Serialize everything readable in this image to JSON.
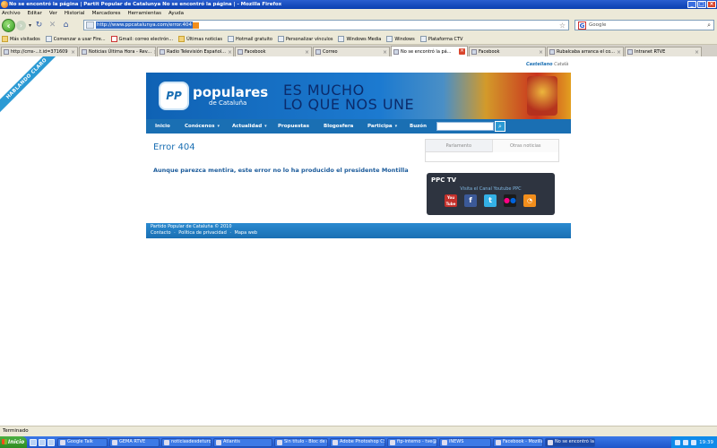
{
  "browser": {
    "title": "No se encontró la página | Partit Popular de Catalunya No se encontró la página | - Mozilla Firefox",
    "menu": [
      "Archivo",
      "Editar",
      "Ver",
      "Historial",
      "Marcadores",
      "Herramientas",
      "Ayuda"
    ],
    "url": "http://www.ppcatalunya.com/error.404",
    "search_placeholder": "Google",
    "status": "Terminado"
  },
  "bookmarks": [
    {
      "label": "Más visitados",
      "icon": "folder-icon"
    },
    {
      "label": "Comenzar a usar Fire...",
      "icon": "page-icon"
    },
    {
      "label": "Gmail: correo electrón...",
      "icon": "gmail-icon"
    },
    {
      "label": "Últimas noticias",
      "icon": "folder-icon"
    },
    {
      "label": "Hotmail gratuito",
      "icon": "page-icon"
    },
    {
      "label": "Personalizar vínculos",
      "icon": "page-icon"
    },
    {
      "label": "Windows Media",
      "icon": "page-icon"
    },
    {
      "label": "Windows",
      "icon": "page-icon"
    },
    {
      "label": "Plataforma CTV",
      "icon": "page-icon"
    }
  ],
  "tabs": [
    {
      "label": "http://cms-...t.id=371609"
    },
    {
      "label": "Noticias Última Hora - Rev..."
    },
    {
      "label": "Radio Televisión Español..."
    },
    {
      "label": "Facebook"
    },
    {
      "label": "Correo"
    },
    {
      "label": "No se encontró la pá..."
    },
    {
      "label": "Facebook"
    },
    {
      "label": "Rubalcaba arranca el co..."
    },
    {
      "label": "Intranet RTVE"
    }
  ],
  "page": {
    "ribbon": "HABLANDO CLARO",
    "lang_1": "Castellano",
    "lang_2": "Català",
    "brand_logo": "PP",
    "brand_name": "populares",
    "brand_sub": "de Cataluña",
    "slogan_1": "ES MUCHO",
    "slogan_2": "LO QUE NOS UNE",
    "nav": [
      {
        "label": "Inicio",
        "caret": false
      },
      {
        "label": "Conócenos",
        "caret": true
      },
      {
        "label": "Actualidad",
        "caret": true
      },
      {
        "label": "Propuestas",
        "caret": false
      },
      {
        "label": "Blogosfera",
        "caret": false
      },
      {
        "label": "Participa",
        "caret": true
      },
      {
        "label": "Buzón",
        "caret": false
      }
    ],
    "error_title": "Error 404",
    "error_msg": "Aunque parezca mentira, este error no lo ha producido el presidente Montilla",
    "widget_tabs": [
      "Parlamento",
      "Otras noticias"
    ],
    "tv_title": "PPC TV",
    "tv_sub": "Visita el Canal Youtube PPC",
    "socials": [
      "youtube-icon",
      "facebook-icon",
      "twitter-icon",
      "flickr-icon",
      "rss-icon"
    ],
    "youtube_label_1": "You",
    "youtube_label_2": "Tube",
    "footer_copy": "Partido Popular de Cataluña © 2010",
    "footer_links": [
      "Contacto",
      "·",
      "Política de privacidad",
      "·",
      "Mapa web"
    ]
  },
  "taskbar": {
    "start": "Inicio",
    "tasks": [
      {
        "label": "Google Talk"
      },
      {
        "label": "GEMA RTVE"
      },
      {
        "label": "noticiasdesdeturqui..."
      },
      {
        "label": "Atlantis"
      },
      {
        "label": "Sin título - Bloc de n..."
      },
      {
        "label": "Adobe Photoshop CS3"
      },
      {
        "label": "ftp-interno - tve@ft..."
      },
      {
        "label": "iNEWS"
      },
      {
        "label": "Facebook - Mozilla F..."
      },
      {
        "label": "No se encontró la p..."
      }
    ],
    "clock": "19:39"
  },
  "colors": {
    "brand_blue": "#1a6fb3",
    "xp_blue": "#245edb",
    "start_green": "#3c9c2e"
  }
}
